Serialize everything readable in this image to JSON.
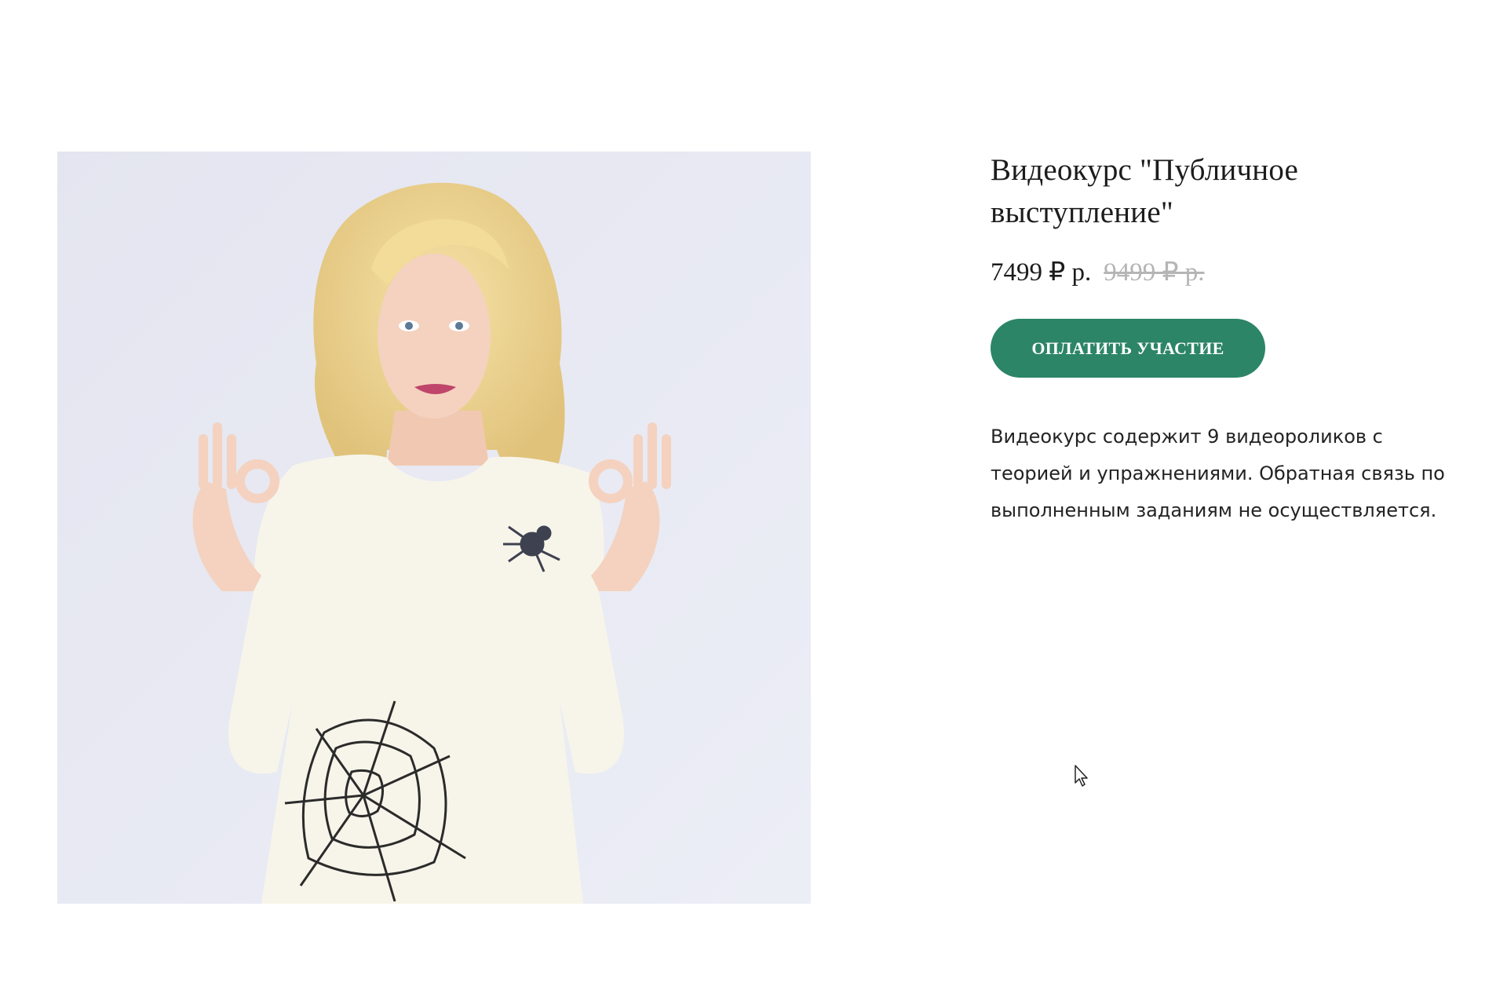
{
  "product": {
    "title_line1": "Видеокурс \"Публичное",
    "title_line2": "выступление\"",
    "price_current": "7499 ₽ р.",
    "price_old": "9499 ₽ р.",
    "button_label": "ОПЛАТИТЬ УЧАСТИЕ",
    "description_line1": "Видеокурс содержит 9 видеороликов с",
    "description_line2": "теорией и упражнениями. Обратная связь по",
    "description_line3": "выполненным заданиям не осуществляется."
  },
  "colors": {
    "accent_button": "#2c8566",
    "old_price": "#b5b5b5",
    "image_background": "#e6e7f1"
  },
  "icons": {
    "cursor": "arrow-cursor-icon"
  }
}
